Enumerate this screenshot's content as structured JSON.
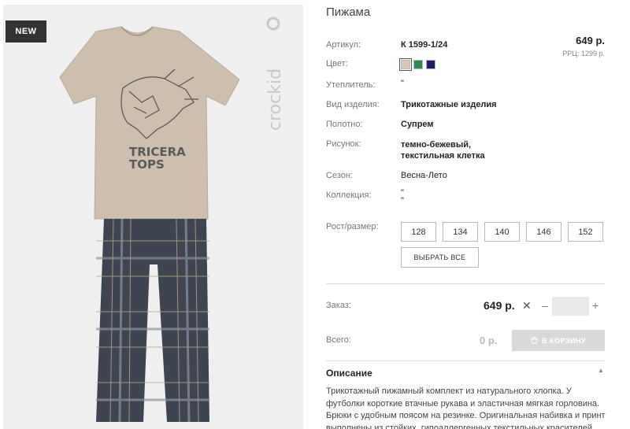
{
  "product": {
    "title": "Пижама",
    "badge": "NEW",
    "brand": "crockid",
    "price": "649 р.",
    "rrp": "РРЦ: 1299 р."
  },
  "attributes": [
    {
      "label": "Артикул:",
      "value": "К 1599-1/24"
    },
    {
      "label": "Цвет:",
      "value": ""
    },
    {
      "label": "Утеплитель:",
      "value": "\""
    },
    {
      "label": "Вид изделия:",
      "value": "Трикотажные изделия"
    },
    {
      "label": "Полотно:",
      "value": "Супрем"
    },
    {
      "label": "Рисунок:",
      "value": "темно-бежевый,\nтекстильная клетка"
    },
    {
      "label": "Сезон:",
      "value": "Весна-Лето"
    },
    {
      "label": "Коллекция:",
      "value": "\"\n\""
    }
  ],
  "colors": [
    "#d8c7b2",
    "#2e8b4f",
    "#1d1f6b"
  ],
  "sizes": {
    "label": "Рост/размер:",
    "options": [
      "128",
      "134",
      "140",
      "146",
      "152"
    ],
    "select_all": "ВЫБРАТЬ ВСЕ"
  },
  "order": {
    "label": "Заказ:",
    "price": "649 р.",
    "times": "✕",
    "minus": "–",
    "plus": "+",
    "quantity": ""
  },
  "total": {
    "label": "Всего:",
    "value": "0 р.",
    "cart_button": "В КОРЗИНУ"
  },
  "description": {
    "title": "Описание",
    "text": "Трикотажный пижамный комплект из натурального хлопка. У футболки короткие втачные рукава и эластичная мягкая горловина. Брюки с удобным поясом на резинке. Оригинальная набивка и принт выполнены из стойких, гипоаллергенных текстильных красителей."
  },
  "print_text": [
    "TRICERA",
    "TOPS"
  ]
}
